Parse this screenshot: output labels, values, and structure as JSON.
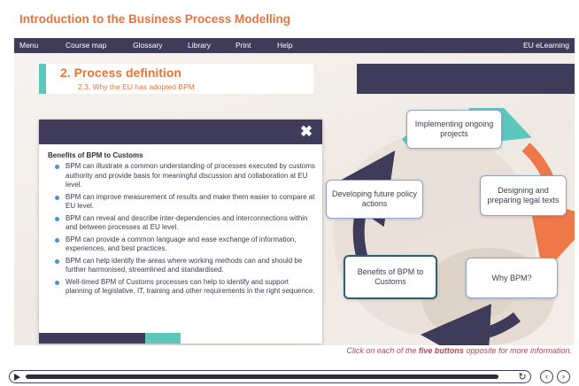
{
  "course_title": "Introduction to the Business Process Modelling",
  "nav": {
    "menu": "Menu",
    "course_map": "Course map",
    "glossary": "Glossary",
    "library": "Library",
    "print": "Print",
    "help": "Help",
    "brand": "EU eLearning"
  },
  "section": {
    "title": "2. Process definition",
    "subtitle": "2.3. Why the EU has adopted BPM"
  },
  "popup": {
    "close_icon": "close-icon",
    "heading": "Benefits of BPM to Customs",
    "bullets": [
      "BPM can illustrate a common understanding of processes executed by customs authority and provide basis for meaningful discussion and collaboration at EU level.",
      "BPM can improve measurement of results and make them easier to compare at EU level.",
      "BPM can reveal and describe inter-dependencies and interconnections within and between processes at EU level.",
      "BPM can provide a common language and ease exchange of information, experiences, and best practices.",
      "BPM can help identify the areas where working methods can and should be further harmonised, streamlined and standardised.",
      "Well-timed BPM of Customs processes can help to identify and support planning of legislative, IT, training and other requirements in the right sequence."
    ]
  },
  "cycle": {
    "buttons": {
      "implementing": "Implementing ongoing projects",
      "designing": "Designing and preparing legal texts",
      "why": "Why BPM?",
      "benefits": "Benefits of BPM to Customs",
      "developing": "Developing future policy actions"
    },
    "colors": {
      "teal": "#5cc7bd",
      "orange": "#ef7848",
      "navy": "#3e3c5a",
      "blue": "#4a6fa5"
    }
  },
  "instruction": {
    "prefix": "Click on each of the",
    "emphasis": "five buttons",
    "suffix": "opposite for more information."
  },
  "player": {
    "progress": 0.97,
    "play_icon": "play-icon",
    "replay_icon": "replay-icon",
    "prev_icon": "chevron-left-icon",
    "next_icon": "chevron-right-icon"
  }
}
